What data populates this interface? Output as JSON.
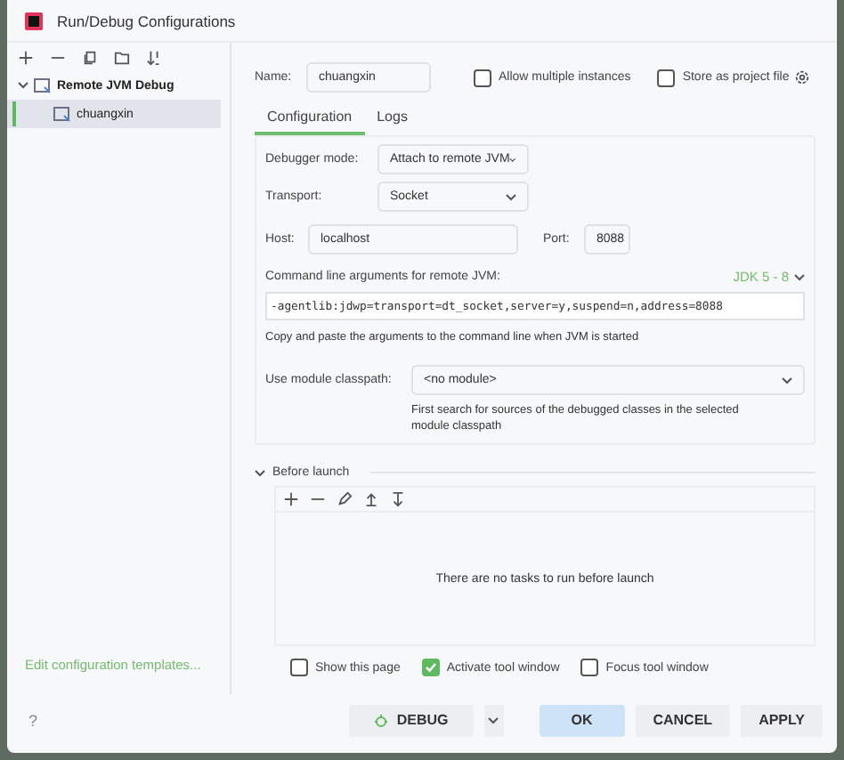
{
  "window": {
    "title": "Run/Debug Configurations"
  },
  "sidebar": {
    "tree": [
      {
        "label": "Remote JVM Debug",
        "expanded": true,
        "selected": false,
        "children": [
          {
            "label": "chuangxin",
            "selected": true
          }
        ]
      }
    ],
    "link": "Edit configuration templates..."
  },
  "name": {
    "label": "Name:",
    "value": "chuangxin"
  },
  "options": [
    {
      "label": "Allow multiple instances",
      "checked": false
    },
    {
      "label": "Store as project file",
      "checked": false
    }
  ],
  "tabs": [
    {
      "label": "Configuration",
      "selected": true
    },
    {
      "label": "Logs",
      "selected": false
    }
  ],
  "config": {
    "debugger_mode": {
      "label": "Debugger mode:",
      "value": "Attach to remote JVM"
    },
    "transport": {
      "label": "Transport:",
      "value": "Socket"
    },
    "host": {
      "label": "Host:",
      "value": "localhost"
    },
    "port": {
      "label": "Port:",
      "value": "8088"
    },
    "args_label": "Command line arguments for remote JVM:",
    "jdk": "JDK 5 - 8",
    "args": "-agentlib:jdwp=transport=dt_socket,server=y,suspend=n,address=8088",
    "args_hint": "Copy and paste the arguments to the command line when JVM is started",
    "module": {
      "label": "Use module classpath:",
      "value": "<no module>"
    },
    "module_hint": "First search for sources of the debugged classes in the selected module classpath"
  },
  "before_launch": {
    "title": "Before launch",
    "expanded": true,
    "empty": "There are no tasks to run before launch"
  },
  "launch_options": [
    {
      "label": "Show this page",
      "checked": false
    },
    {
      "label": "Activate tool window",
      "checked": true
    },
    {
      "label": "Focus tool window",
      "checked": false
    }
  ],
  "help": "?",
  "buttons": [
    {
      "kind": "debug",
      "label": "DEBUG"
    },
    {
      "kind": "ok",
      "label": "OK"
    },
    {
      "kind": "plain",
      "label": "CANCEL"
    },
    {
      "kind": "plain",
      "label": "APPLY"
    }
  ]
}
